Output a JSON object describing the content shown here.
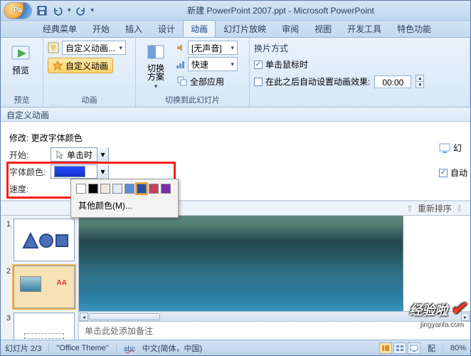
{
  "titlebar": {
    "title": "新建 PowerPoint 2007.ppt - Microsoft PowerPoint"
  },
  "tabs": {
    "items": [
      {
        "label": "经典菜单"
      },
      {
        "label": "开始"
      },
      {
        "label": "插入"
      },
      {
        "label": "设计"
      },
      {
        "label": "动画"
      },
      {
        "label": "幻灯片放映"
      },
      {
        "label": "审阅"
      },
      {
        "label": "视图"
      },
      {
        "label": "开发工具"
      },
      {
        "label": "特色功能"
      }
    ],
    "active_index": 4
  },
  "ribbon": {
    "preview": {
      "label": "预览",
      "group": "预览"
    },
    "anim": {
      "custom_combo": "自定义动画...",
      "custom_btn": "自定义动画",
      "group": "动画"
    },
    "switch": {
      "label": "切换\n方案",
      "no_sound": "[无声音]",
      "speed": "快速",
      "apply_all": "全部应用",
      "group": "切换到此幻灯片"
    },
    "transition": {
      "heading": "换片方式",
      "on_click": "单击鼠标时",
      "after": "在此之后自动设置动画效果:",
      "time": "00:00"
    }
  },
  "pane_header": "自定义动画",
  "settings": {
    "modify_label": "修改: 更改字体颜色",
    "start_label": "开始:",
    "start_value": "单击时",
    "color_label": "字体颜色:",
    "speed_label": "速度:",
    "more_colors": "其他颜色(M)...",
    "swatches": [
      "#ffffff",
      "#000000",
      "#ece7d8",
      "#e2ecf6",
      "#5a8fcf",
      "#2b4ea0",
      "#c3425d",
      "#7a2da8"
    ],
    "selected_swatch_index": 5
  },
  "reorder": {
    "label": "重新排序",
    "arrow_up": "⇧",
    "arrow_down": "⇩"
  },
  "right": {
    "sideshow": "幻",
    "autoplay": "自动"
  },
  "thumbnails": {
    "count": 3,
    "selected": 2
  },
  "notes_placeholder": "单击此处添加备注",
  "status": {
    "slide_info": "幻灯片 2/3",
    "theme": "\"Office Theme\"",
    "lang": "中文(简体，中国)",
    "scheme_label": "配",
    "zoom": "80%"
  },
  "watermark": {
    "text": "经验啦",
    "sub": "jingyanla.com"
  }
}
